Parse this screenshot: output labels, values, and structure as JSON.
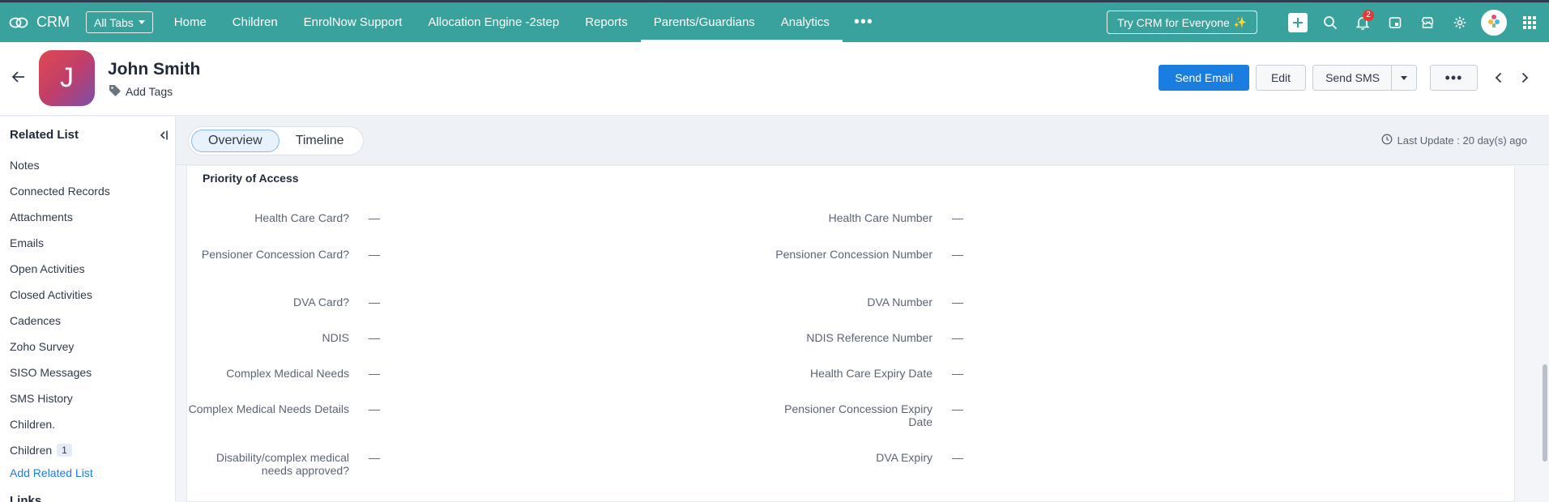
{
  "topnav": {
    "brand": "CRM",
    "all_tabs": "All Tabs",
    "tabs": [
      {
        "label": "Home",
        "active": false
      },
      {
        "label": "Children",
        "active": false
      },
      {
        "label": "EnrolNow Support",
        "active": false
      },
      {
        "label": "Allocation Engine -2step",
        "active": false
      },
      {
        "label": "Reports",
        "active": false
      },
      {
        "label": "Parents/Guardians",
        "active": true
      },
      {
        "label": "Analytics",
        "active": false
      }
    ],
    "more": "•••",
    "try_button": "Try CRM for Everyone",
    "notification_count": "2"
  },
  "record": {
    "avatar_letter": "J",
    "name": "John Smith",
    "add_tags": "Add Tags",
    "actions": {
      "send_email": "Send Email",
      "edit": "Edit",
      "send_sms": "Send SMS",
      "more": "•••"
    }
  },
  "sidebar": {
    "title": "Related List",
    "items": [
      {
        "label": "Notes",
        "count": ""
      },
      {
        "label": "Connected Records",
        "count": ""
      },
      {
        "label": "Attachments",
        "count": ""
      },
      {
        "label": "Emails",
        "count": ""
      },
      {
        "label": "Open Activities",
        "count": ""
      },
      {
        "label": "Closed Activities",
        "count": ""
      },
      {
        "label": "Cadences",
        "count": ""
      },
      {
        "label": "Zoho Survey",
        "count": ""
      },
      {
        "label": "SISO Messages",
        "count": ""
      },
      {
        "label": "SMS History",
        "count": ""
      },
      {
        "label": "Children.",
        "count": ""
      },
      {
        "label": "Children",
        "count": "1"
      }
    ],
    "add_related_list": "Add Related List",
    "links_title": "Links"
  },
  "tabs": {
    "overview": "Overview",
    "timeline": "Timeline",
    "last_update": "Last Update : 20 day(s) ago"
  },
  "section": {
    "title": "Priority of Access",
    "left_fields": [
      {
        "label": "Health Care Card?",
        "value": "—"
      },
      {
        "label": "Pensioner Concession Card?",
        "value": "—"
      },
      {
        "label": "DVA Card?",
        "value": "—"
      },
      {
        "label": "NDIS",
        "value": "—"
      },
      {
        "label": "Complex Medical Needs",
        "value": "—"
      },
      {
        "label": "Complex Medical Needs Details",
        "value": "—"
      },
      {
        "label": "Disability/complex medical needs approved?",
        "value": "—"
      }
    ],
    "right_fields": [
      {
        "label": "Health Care Number",
        "value": "—"
      },
      {
        "label": "Pensioner Concession Number",
        "value": "—"
      },
      {
        "label": "DVA Number",
        "value": "—"
      },
      {
        "label": "NDIS Reference Number",
        "value": "—"
      },
      {
        "label": "Health Care Expiry Date",
        "value": "—"
      },
      {
        "label": "Pensioner Concession Expiry Date",
        "value": "—"
      },
      {
        "label": "DVA Expiry",
        "value": "—"
      }
    ]
  }
}
